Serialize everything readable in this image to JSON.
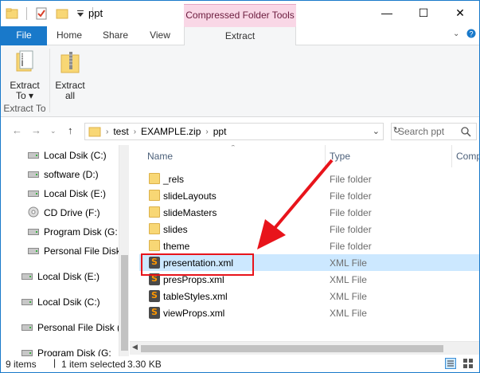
{
  "window": {
    "title": "ppt",
    "context_tab_title": "Compressed Folder Tools",
    "controls": {
      "minimize": "—",
      "maximize": "☐",
      "close": "✕"
    }
  },
  "ribbon_tabs": {
    "file": "File",
    "home": "Home",
    "share": "Share",
    "view": "View",
    "extract": "Extract"
  },
  "ribbon": {
    "extract_to_line1": "Extract",
    "extract_to_line2": "To ▾",
    "extract_all_line1": "Extract",
    "extract_all_line2": "all",
    "group_label": "Extract To"
  },
  "address": {
    "crumbs": [
      "test",
      "EXAMPLE.zip",
      "ppt"
    ],
    "search_placeholder": "Search ppt"
  },
  "nav_pane": [
    {
      "label": "Local Dsik (C:)",
      "icon": "windows-drive-icon"
    },
    {
      "label": "software (D:)",
      "icon": "drive-icon"
    },
    {
      "label": "Local Disk (E:)",
      "icon": "drive-icon"
    },
    {
      "label": "CD Drive (F:)",
      "icon": "cd-drive-icon"
    },
    {
      "label": "Program Disk  (G:",
      "icon": "drive-icon"
    },
    {
      "label": "Personal File Disk",
      "icon": "drive-icon"
    },
    {
      "label": "Local Disk (E:)",
      "icon": "drive-icon"
    },
    {
      "label": "Local Dsik (C:)",
      "icon": "windows-drive-icon"
    },
    {
      "label": "Personal File Disk (I",
      "icon": "drive-icon"
    },
    {
      "label": "Program Disk  (G:",
      "icon": "drive-icon"
    }
  ],
  "columns": {
    "name": "Name",
    "type": "Type",
    "comp": "Comp"
  },
  "files": [
    {
      "name": "_rels",
      "type": "File folder",
      "kind": "folder"
    },
    {
      "name": "slideLayouts",
      "type": "File folder",
      "kind": "folder"
    },
    {
      "name": "slideMasters",
      "type": "File folder",
      "kind": "folder"
    },
    {
      "name": "slides",
      "type": "File folder",
      "kind": "folder"
    },
    {
      "name": "theme",
      "type": "File folder",
      "kind": "folder"
    },
    {
      "name": "presentation.xml",
      "type": "XML File",
      "kind": "xml",
      "selected": true
    },
    {
      "name": "presProps.xml",
      "type": "XML File",
      "kind": "xml"
    },
    {
      "name": "tableStyles.xml",
      "type": "XML File",
      "kind": "xml"
    },
    {
      "name": "viewProps.xml",
      "type": "XML File",
      "kind": "xml"
    }
  ],
  "status": {
    "count": "9 items",
    "selected": "1 item selected",
    "size": "3.30 KB"
  },
  "colors": {
    "accent": "#1979ca",
    "context_tab": "#f9d7e6",
    "selection": "#cce8ff",
    "annotation": "#e8141b"
  }
}
